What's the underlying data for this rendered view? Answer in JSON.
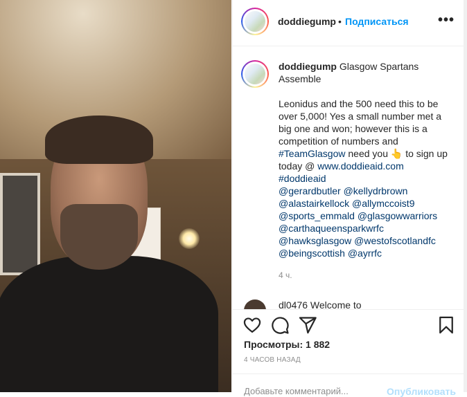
{
  "post": {
    "username": "doddiegump",
    "dot": "•",
    "follow_label": "Подписаться",
    "more_label": "•••"
  },
  "caption": {
    "username": "doddiegump",
    "title": "Glasgow Spartans Assemble",
    "body_before": "Leonidus and the 500 need this to be over 5,000! Yes a small number met a big one and won; however this is a competition of numbers and ",
    "hashtag_team": "#TeamGlasgow",
    "body_mid": " need you ",
    "emoji": "👆",
    "body_after": " to sign up today @ ",
    "url": "www.doddieaid.com",
    "hashtag_doddie": "#doddieaid",
    "mentions_1a": "@gerardbutler",
    "mentions_1b": "@kellydrbrown",
    "mentions_2a": "@alastairkellock",
    "mentions_2b": "@allymccoist9",
    "mentions_3a": "@sports_emmald",
    "mentions_3b": "@glasgowwarriors",
    "mentions_4a": "@carthaqueensparkwrfc",
    "mentions_5a": "@hawksglasgow",
    "mentions_5b": "@westofscotlandfc",
    "mentions_6a": "@beingscottish",
    "mentions_6b": "@ayrrfc",
    "timestamp": "4 ч."
  },
  "next_comment": {
    "text": "dl0476 Welcome to"
  },
  "actions": {
    "like_icon": "heart-icon",
    "comment_icon": "speech-bubble-icon",
    "share_icon": "paper-plane-icon",
    "save_icon": "bookmark-icon"
  },
  "views_label": "Просмотры: 1 882",
  "time_ago": "4 ЧАСОВ НАЗАД",
  "comment_input": {
    "placeholder": "Добавьте комментарий...",
    "publish_label": "Опубликовать"
  },
  "colors": {
    "accent": "#0095f6",
    "link": "#00376b",
    "muted": "#8e8e8e",
    "text": "#262626"
  }
}
